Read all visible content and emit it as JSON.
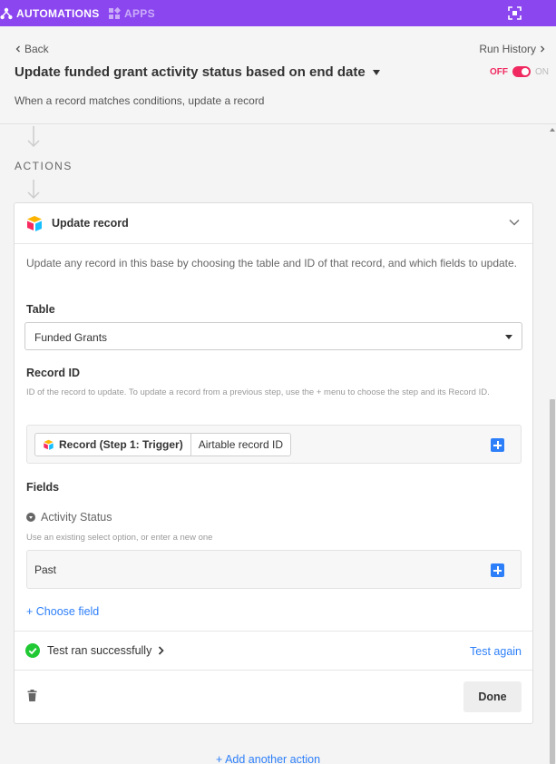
{
  "topbar": {
    "tabs": [
      {
        "label": "AUTOMATIONS",
        "icon": "automations-icon",
        "active": true
      },
      {
        "label": "APPS",
        "icon": "apps-icon",
        "active": false
      }
    ],
    "expand_icon": "expand-icon"
  },
  "header": {
    "back_label": "Back",
    "run_history_label": "Run History",
    "title": "Update funded grant activity status based on end date",
    "subtitle": "When a record matches conditions, update a record",
    "toggle": {
      "off_label": "OFF",
      "on_label": "ON",
      "state": "off"
    }
  },
  "actions_label": "ACTIONS",
  "action_card": {
    "title": "Update record",
    "description": "Update any record in this base by choosing the table and ID of that record, and which fields to update.",
    "table": {
      "label": "Table",
      "selected": "Funded Grants"
    },
    "record_id": {
      "label": "Record ID",
      "help": "ID of the record to update. To update a record from a previous step, use the + menu to choose the step and its Record ID.",
      "token_source": "Record (Step 1: Trigger)",
      "token_field": "Airtable record ID"
    },
    "fields": {
      "label": "Fields",
      "items": [
        {
          "name": "Activity Status",
          "help": "Use an existing select option, or enter a new one",
          "value": "Past"
        }
      ],
      "choose_field_label": "+ Choose field"
    },
    "test": {
      "status": "Test ran successfully",
      "again_label": "Test again"
    },
    "done_label": "Done"
  },
  "add_another_label": "+ Add another action",
  "colors": {
    "accent": "#8b46f0",
    "link": "#2d7ff9",
    "off": "#f02a60",
    "success": "#20c933"
  }
}
